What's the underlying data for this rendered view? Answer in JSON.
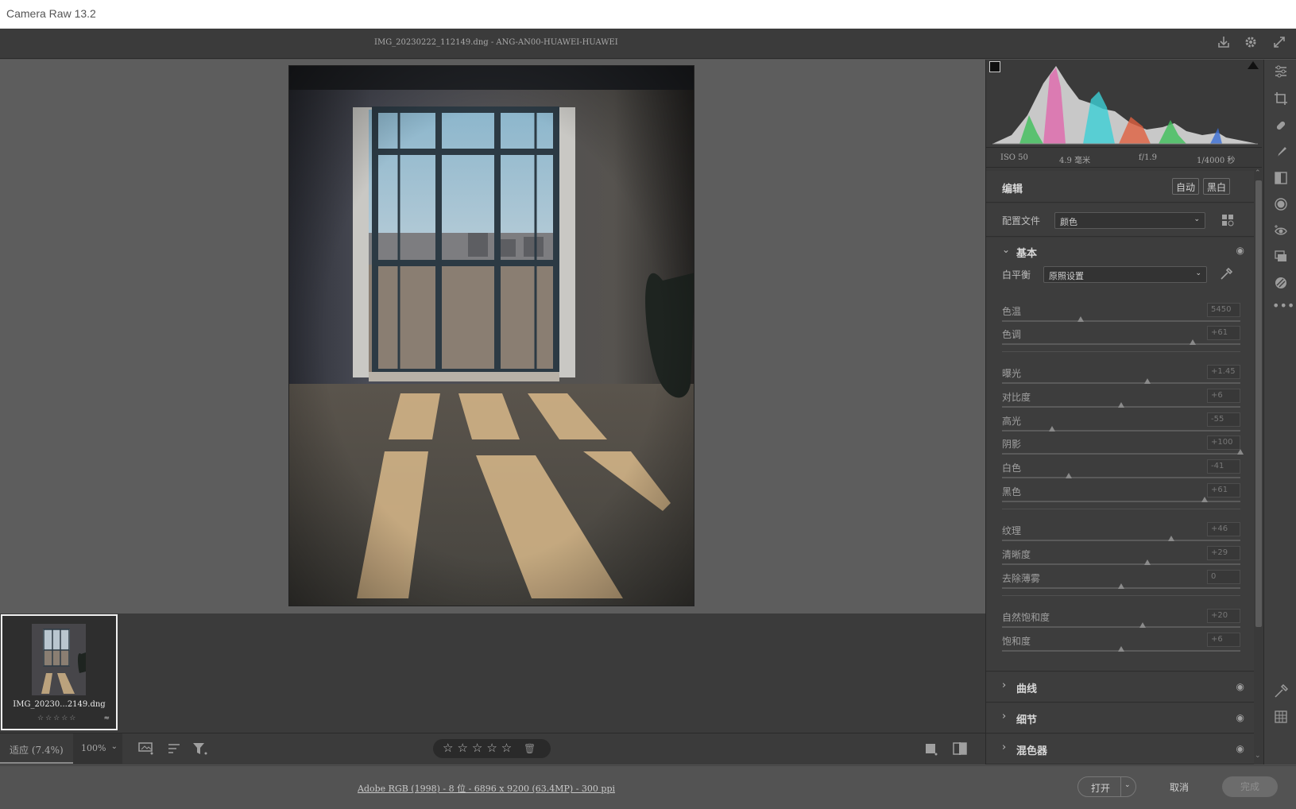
{
  "window": {
    "title": "Camera Raw 13.2"
  },
  "topbar": {
    "filename": "IMG_20230222_112149.dng -  ANG-AN00-HUAWEI-HUAWEI",
    "icons": [
      "save-icon",
      "settings-gear-icon",
      "fullscreen-icon"
    ]
  },
  "filmstrip": {
    "items": [
      {
        "name": "IMG_20230...2149.dng",
        "stars": "☆☆☆☆☆",
        "adjusted_icon": "≈"
      }
    ]
  },
  "bottombar": {
    "zoom_fit": "适应 (7.4%)",
    "zoom_pct": "100%",
    "rating": "☆☆☆☆☆",
    "trash": "🗑"
  },
  "statusbar": {
    "info": "Adobe RGB (1998) - 8 位 - 6896 x 9200 (63.4MP) - 300 ppi",
    "open": "打开",
    "cancel": "取消",
    "done": "完成"
  },
  "exif": {
    "iso": "ISO 50",
    "focal": "4.9 毫米",
    "aperture": "f/1.9",
    "shutter": "1/4000 秒"
  },
  "edit": {
    "title": "编辑",
    "auto": "自动",
    "bw": "黑白"
  },
  "profile": {
    "label": "配置文件",
    "value": "颜色"
  },
  "basic": {
    "title": "基本",
    "wb_label": "白平衡",
    "wb_value": "原照设置",
    "sliders": [
      {
        "label": "色温",
        "value": "5450",
        "pos": 0.33
      },
      {
        "label": "色调",
        "value": "+61",
        "pos": 0.8
      },
      {
        "label": "曝光",
        "value": "+1.45",
        "pos": 0.61
      },
      {
        "label": "对比度",
        "value": "+6",
        "pos": 0.5
      },
      {
        "label": "高光",
        "value": "-55",
        "pos": 0.21
      },
      {
        "label": "阴影",
        "value": "+100",
        "pos": 1.0
      },
      {
        "label": "白色",
        "value": "-41",
        "pos": 0.28
      },
      {
        "label": "黑色",
        "value": "+61",
        "pos": 0.85
      },
      {
        "label": "纹理",
        "value": "+46",
        "pos": 0.71
      },
      {
        "label": "清晰度",
        "value": "+29",
        "pos": 0.61
      },
      {
        "label": "去除薄雾",
        "value": "0",
        "pos": 0.5
      },
      {
        "label": "自然饱和度",
        "value": "+20",
        "pos": 0.59
      },
      {
        "label": "饱和度",
        "value": "+6",
        "pos": 0.5
      }
    ]
  },
  "panels": {
    "curve": "曲线",
    "detail": "细节",
    "mixer": "混色器"
  }
}
